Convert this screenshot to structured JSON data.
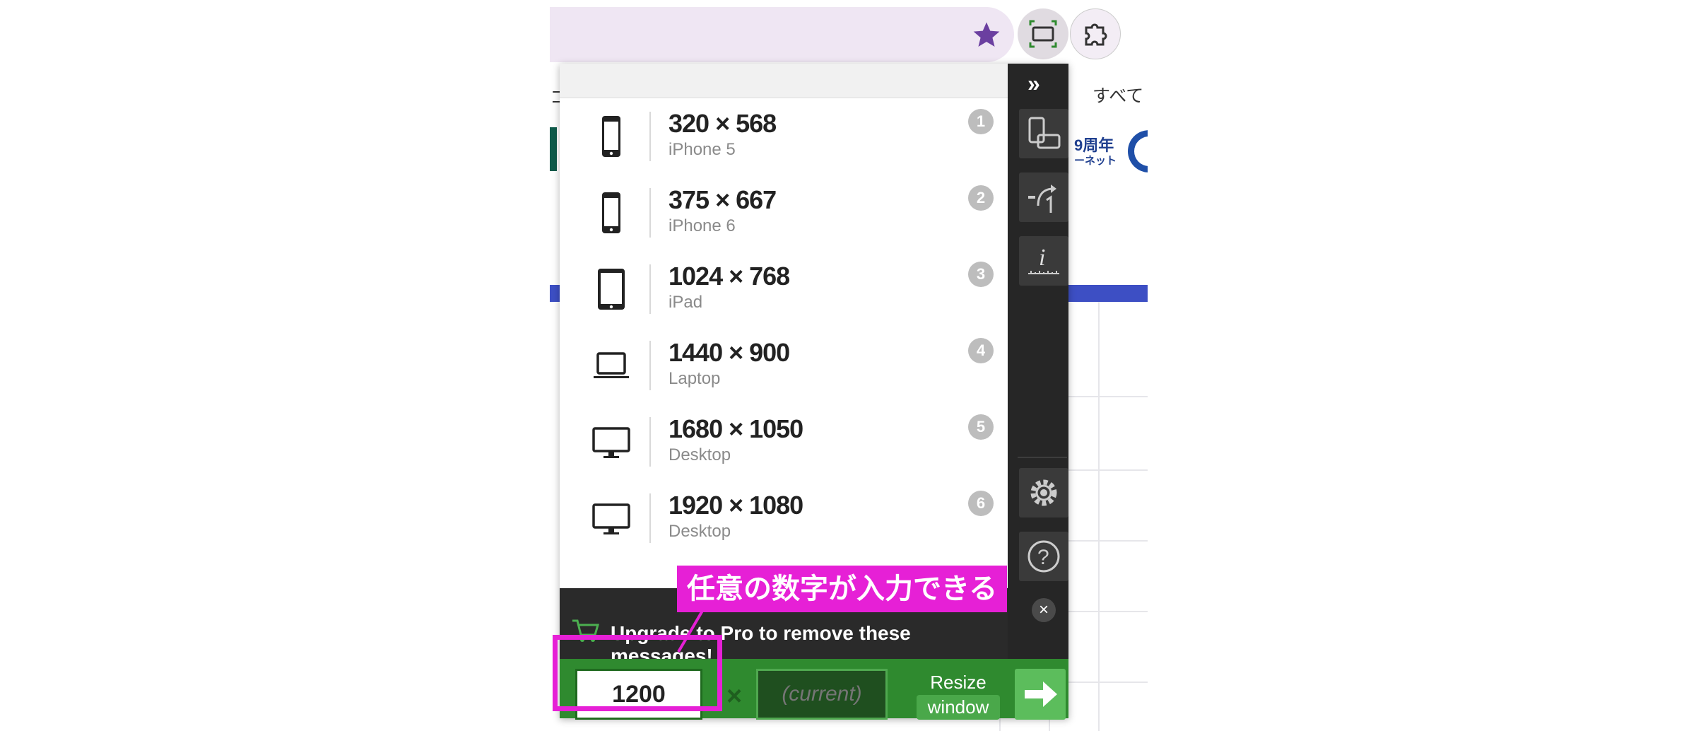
{
  "colors": {
    "accent_green": "#2f8a2f",
    "sidebar": "#262626",
    "annotation_magenta": "#e620d6",
    "omnibox": "#efe6f3",
    "star": "#6b3fa0"
  },
  "browser": {
    "star_icon": "star-icon",
    "extension_active_icon": "resize-window-icon",
    "extensions_icon": "puzzle-icon"
  },
  "background_page": {
    "top_right_text": "すべて",
    "top_left_char": "コ",
    "anniversary": "9周年",
    "anniversary_sub": "ーネット"
  },
  "popup": {
    "collapse_label": "»",
    "devices": [
      {
        "dimensions": "320 × 568",
        "label": "iPhone 5",
        "number": "1",
        "icon": "phone-icon"
      },
      {
        "dimensions": "375 × 667",
        "label": "iPhone 6",
        "number": "2",
        "icon": "phone-icon"
      },
      {
        "dimensions": "1024 × 768",
        "label": "iPad",
        "number": "3",
        "icon": "tablet-icon"
      },
      {
        "dimensions": "1440 × 900",
        "label": "Laptop",
        "number": "4",
        "icon": "laptop-icon"
      },
      {
        "dimensions": "1680 × 1050",
        "label": "Desktop",
        "number": "5",
        "icon": "monitor-icon"
      },
      {
        "dimensions": "1920 × 1080",
        "label": "Desktop",
        "number": "6",
        "icon": "monitor-icon"
      }
    ],
    "message": "Upgrade to Pro to remove these messages!",
    "close_label": "×",
    "width_value": "1200",
    "times_sign": "×",
    "height_placeholder": "(current)",
    "resize_label_1": "Resize",
    "resize_label_2": "window"
  },
  "annotation": {
    "callout_text": "任意の数字が入力できる"
  }
}
